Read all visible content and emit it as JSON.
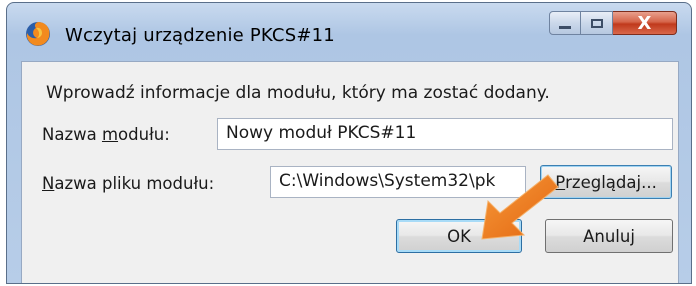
{
  "window": {
    "title": "Wczytaj urządzenie PKCS#11",
    "close_glyph": "X"
  },
  "dialog": {
    "prompt": "Wprowadź informacje dla modułu, który ma zostać dodany.",
    "module_name": {
      "label_pre": "Nazwa ",
      "label_accel": "m",
      "label_post": "odułu:",
      "value": "Nowy moduł PKCS#11"
    },
    "module_file": {
      "label_accel": "N",
      "label_post": "azwa pliku modułu:",
      "value": "C:\\Windows\\System32\\pk"
    },
    "browse_button": {
      "accel": "P",
      "rest": "rzeglądaj..."
    },
    "ok_label": "OK",
    "cancel_label": "Anuluj"
  },
  "colors": {
    "titlebar": "#c9daef",
    "close_button": "#c0391c",
    "arrow": "#f07820",
    "focus_border": "#3c7fb1"
  },
  "icons": {
    "app": "firefox-icon",
    "pointer": "orange-arrow-icon"
  }
}
